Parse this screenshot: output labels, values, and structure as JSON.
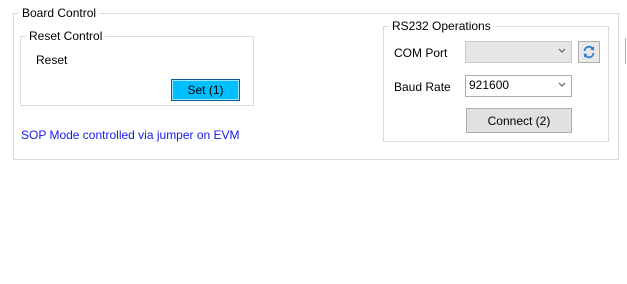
{
  "board_control": {
    "title": "Board Control",
    "reset_control": {
      "title": "Reset Control",
      "reset_label": "Reset",
      "set_button": "Set (1)",
      "set_button_color": "#00bfff"
    },
    "sop_note": "SOP Mode controlled via jumper on EVM",
    "sop_note_color": "#1a1ae6",
    "rs232": {
      "title": "RS232 Operations",
      "com_port_label": "COM Port",
      "com_port_value": "",
      "refresh_icon": "refresh-icon",
      "baud_rate_label": "Baud Rate",
      "baud_rate_value": "921600",
      "connect_button": "Connect (2)"
    }
  }
}
